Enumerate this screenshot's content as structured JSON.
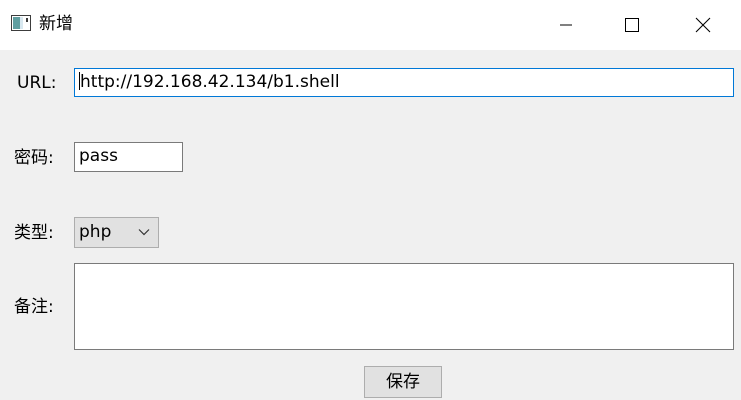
{
  "window": {
    "title": "新增",
    "icon": "app-window-icon",
    "controls": {
      "minimize_icon": "minimize-icon",
      "maximize_icon": "maximize-icon",
      "close_icon": "close-icon"
    }
  },
  "form": {
    "url": {
      "label": "URL:",
      "value": "http://192.168.42.134/b1.shell"
    },
    "password": {
      "label": "密码:",
      "value": "pass"
    },
    "type": {
      "label": "类型:",
      "selected": "php",
      "icon": "chevron-down-icon"
    },
    "note": {
      "label": "备注:",
      "value": ""
    },
    "save_label": "保存"
  },
  "colors": {
    "window_bg": "#f0f0f0",
    "titlebar_bg": "#ffffff",
    "focus_border": "#0078d7",
    "button_bg": "#e1e1e1"
  }
}
